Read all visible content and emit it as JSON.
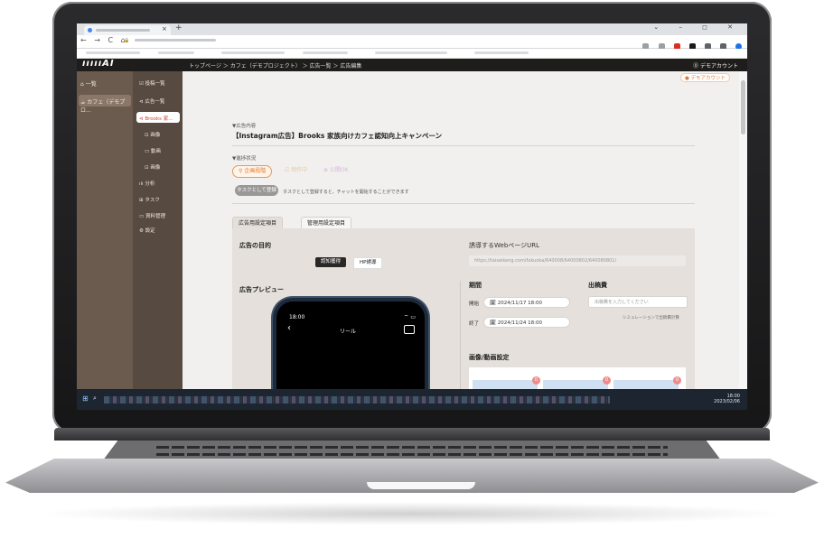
{
  "browser": {
    "new_tab": "+",
    "tab_close": "×",
    "window_controls": "⌄ – ◻ ✕",
    "nav": "← → C ⌂",
    "url_prefix": "🔒",
    "ext_colors": [
      "#9aa0a6",
      "#9aa0a6",
      "#d93025",
      "#1a1a1a",
      "#5f6368",
      "#5f6368",
      "#1a73e8"
    ]
  },
  "app": {
    "logo": "ıııııAI",
    "breadcrumb": "トップページ ＞ カフェ（デモプロジェクト） ＞ 広告一覧 ＞ 広告編集",
    "account": "⓪ デモアカウント",
    "account_badge": "● デモアカウント"
  },
  "sidebar1": {
    "items": [
      {
        "label": "⌂ 一覧"
      },
      {
        "label": "☕ カフェ（デモプロ..."
      }
    ]
  },
  "sidebar2": {
    "items": [
      {
        "label": "☑ 投稿一覧"
      },
      {
        "label": "⊲ 広告一覧"
      },
      {
        "label": "⊲ Brooks 家..."
      },
      {
        "label": "⊡ 画像"
      },
      {
        "label": "▭ 動画"
      },
      {
        "label": "⊡ 画像"
      },
      {
        "label": "ılı 分析"
      },
      {
        "label": "⊞ タスク"
      },
      {
        "label": "▭ 資料管理"
      },
      {
        "label": "⚙ 設定"
      }
    ]
  },
  "main": {
    "content_label": "▼広告内容",
    "title": "【Instagram広告】Brooks 家族向けカフェ認知向上キャンペーン",
    "progress_label": "▼進捗状況",
    "statuses": [
      {
        "label": "⚲ 企画段階"
      },
      {
        "label": "☑ 制作中"
      },
      {
        "label": "⊕ 公開OK"
      }
    ],
    "task_button": "タスクとして登録",
    "task_note": "タスクとして登録すると、チャットを開始することができます",
    "tabs": [
      "広告用設定項目",
      "管理用設定項目"
    ],
    "purpose_label": "広告の目的",
    "purpose_options": [
      "認知獲得",
      "HP誘導"
    ],
    "url_label": "誘導するWebページURL",
    "url_placeholder": "https://taiseikeng.com/fukuoka/640008/64000802/640080801/",
    "preview_label": "広告プレビュー",
    "phone": {
      "time": "18:00",
      "back": "‹",
      "title": "リール",
      "signal": "⌔ ▭"
    },
    "period_label": "期間",
    "start_label": "開始",
    "start_value": "🗓 2024/11/17 18:00",
    "end_label": "終了",
    "end_value": "🗓 2024/11/24 18:00",
    "cost_label": "出稿費",
    "cost_placeholder": "出稿費を入力してください",
    "sim_link": "シミュレーションで出稿費計算",
    "media_label": "画像/動画設定",
    "media_badges": [
      "0",
      "0",
      "0"
    ]
  },
  "taskbar": {
    "clock_time": "18:00",
    "clock_date": "2023/02/06"
  }
}
